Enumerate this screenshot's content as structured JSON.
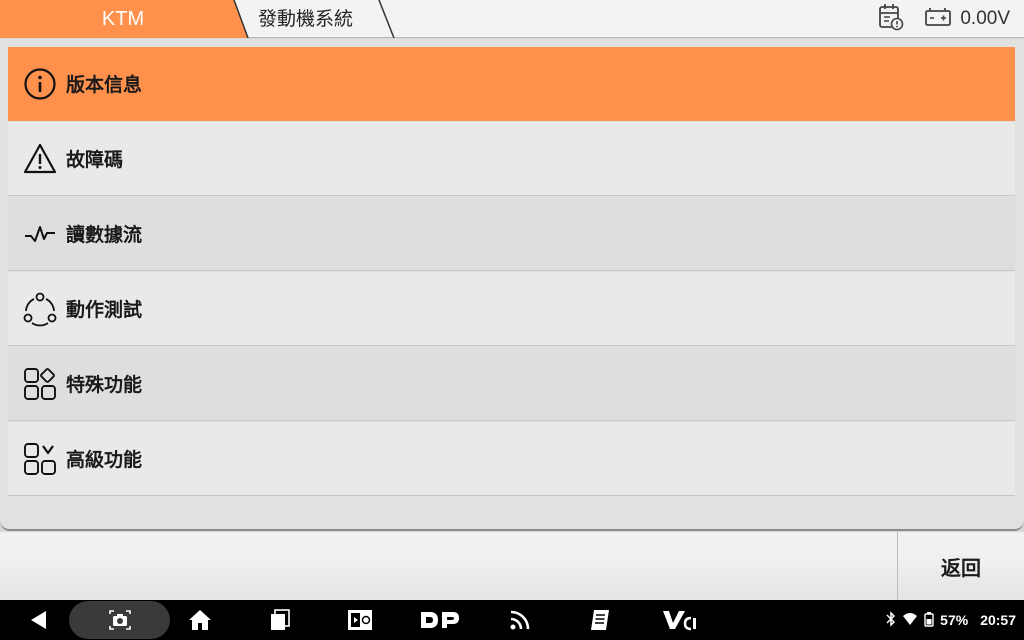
{
  "breadcrumb": {
    "brand": "KTM",
    "system": "發動機系統"
  },
  "header": {
    "voltage": "0.00V",
    "icons": [
      "calendar-alert-icon",
      "battery-icon"
    ]
  },
  "menu": {
    "items": [
      {
        "label": "版本信息",
        "icon": "info-circle-icon",
        "selected": true
      },
      {
        "label": "故障碼",
        "icon": "warning-triangle-icon"
      },
      {
        "label": "讀數據流",
        "icon": "pulse-wave-icon"
      },
      {
        "label": "動作測試",
        "icon": "actuation-cycle-icon"
      },
      {
        "label": "特殊功能",
        "icon": "special-grid-icon"
      },
      {
        "label": "高級功能",
        "icon": "advanced-grid-icon"
      }
    ]
  },
  "actions": {
    "back_label": "返回"
  },
  "navbar": {
    "icons": [
      "back-triangle-icon",
      "screenshot-icon",
      "home-icon",
      "recents-icon",
      "remote-icon",
      "dp-icon",
      "feed-icon",
      "manual-icon",
      "vci-icon"
    ]
  },
  "status": {
    "battery": "57%",
    "time": "20:57"
  },
  "colors": {
    "accent": "#ff914d",
    "navbar": "#000000"
  }
}
